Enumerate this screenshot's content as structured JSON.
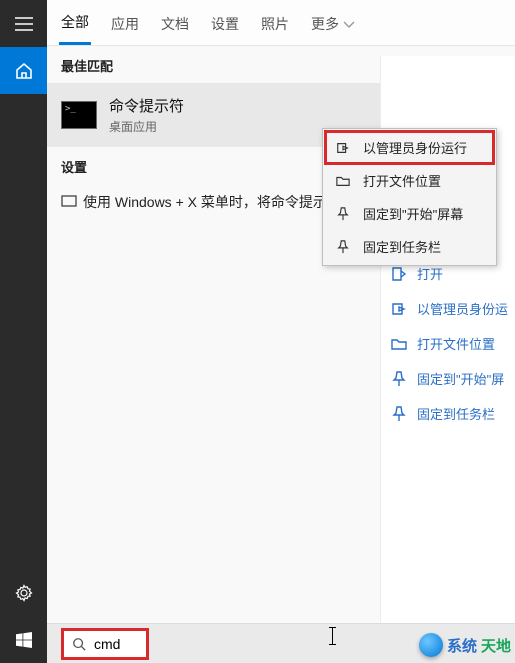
{
  "tabs": {
    "items": [
      "全部",
      "应用",
      "文档",
      "设置",
      "照片"
    ],
    "more": "更多",
    "active_index": 0
  },
  "best_match": {
    "section_label": "最佳匹配",
    "title": "命令提示符",
    "subtitle": "桌面应用"
  },
  "settings": {
    "section_label": "设置",
    "item_text": "使用 Windows + X 菜单时，将命令提示符替换为 Windows"
  },
  "context_menu": {
    "items": [
      {
        "label": "以管理员身份运行",
        "icon": "run-as-admin-icon",
        "highlight": true
      },
      {
        "label": "打开文件位置",
        "icon": "folder-open-icon",
        "highlight": false
      },
      {
        "label": "固定到\"开始\"屏幕",
        "icon": "pin-start-icon",
        "highlight": false
      },
      {
        "label": "固定到任务栏",
        "icon": "pin-taskbar-icon",
        "highlight": false
      }
    ]
  },
  "right_panel": {
    "links": [
      {
        "label": "打开",
        "icon": "open-icon"
      },
      {
        "label": "以管理员身份运",
        "icon": "run-as-admin-icon"
      },
      {
        "label": "打开文件位置",
        "icon": "folder-open-icon"
      },
      {
        "label": "固定到\"开始\"屏",
        "icon": "pin-start-icon"
      },
      {
        "label": "固定到任务栏",
        "icon": "pin-taskbar-icon"
      }
    ]
  },
  "search": {
    "value": "cmd"
  },
  "watermark": {
    "a": "系统",
    "b": "天地"
  },
  "colors": {
    "accent": "#0078d7",
    "highlight": "#d82a2a",
    "link": "#2a6ec6"
  }
}
